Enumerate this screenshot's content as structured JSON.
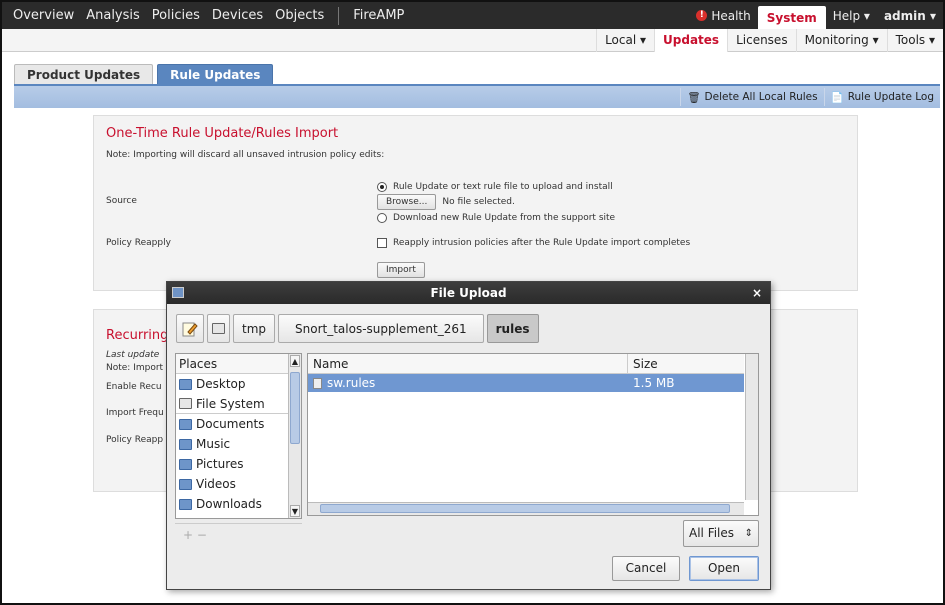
{
  "topnav": {
    "items": [
      "Overview",
      "Analysis",
      "Policies",
      "Devices",
      "Objects"
    ],
    "extra": "FireAMP",
    "health": "Health",
    "system": "System",
    "help": "Help ▾",
    "admin": "admin ▾"
  },
  "subnav": {
    "items": [
      "Local ▾",
      "Updates",
      "Licenses",
      "Monitoring ▾",
      "Tools ▾"
    ]
  },
  "page_tabs": [
    "Product Updates",
    "Rule Updates"
  ],
  "toolbar": {
    "delete_label": "Delete All Local Rules",
    "log_label": "Rule Update Log"
  },
  "import_panel": {
    "title": "One-Time Rule Update/Rules Import",
    "note": "Note: Importing will discard all unsaved intrusion policy edits:",
    "source_label": "Source",
    "radio1": "Rule Update or text rule file to upload and install",
    "browse": "Browse...",
    "no_file": "No file selected.",
    "radio2": "Download new Rule Update from the support site",
    "reapply_label": "Policy Reapply",
    "reapply_check": "Reapply intrusion policies after the Rule Update import completes",
    "import_btn": "Import"
  },
  "recurring_panel": {
    "title": "Recurring",
    "last_update": "Last update",
    "note": "Note: Import",
    "enable": "Enable Recu",
    "frequency": "Import Frequ",
    "reapply": "Policy Reapp"
  },
  "dialog": {
    "title": "File Upload",
    "close": "×",
    "path": [
      "tmp",
      "Snort_talos-supplement_261",
      "rules"
    ],
    "places_header": "Places",
    "places": [
      "Desktop",
      "File System",
      "Documents",
      "Music",
      "Pictures",
      "Videos",
      "Downloads"
    ],
    "add_remove": "+   −",
    "col_name": "Name",
    "col_size": "Size",
    "files": [
      {
        "name": "sw.rules",
        "size": "1.5 MB"
      }
    ],
    "filter": "All Files",
    "cancel": "Cancel",
    "open": "Open"
  }
}
